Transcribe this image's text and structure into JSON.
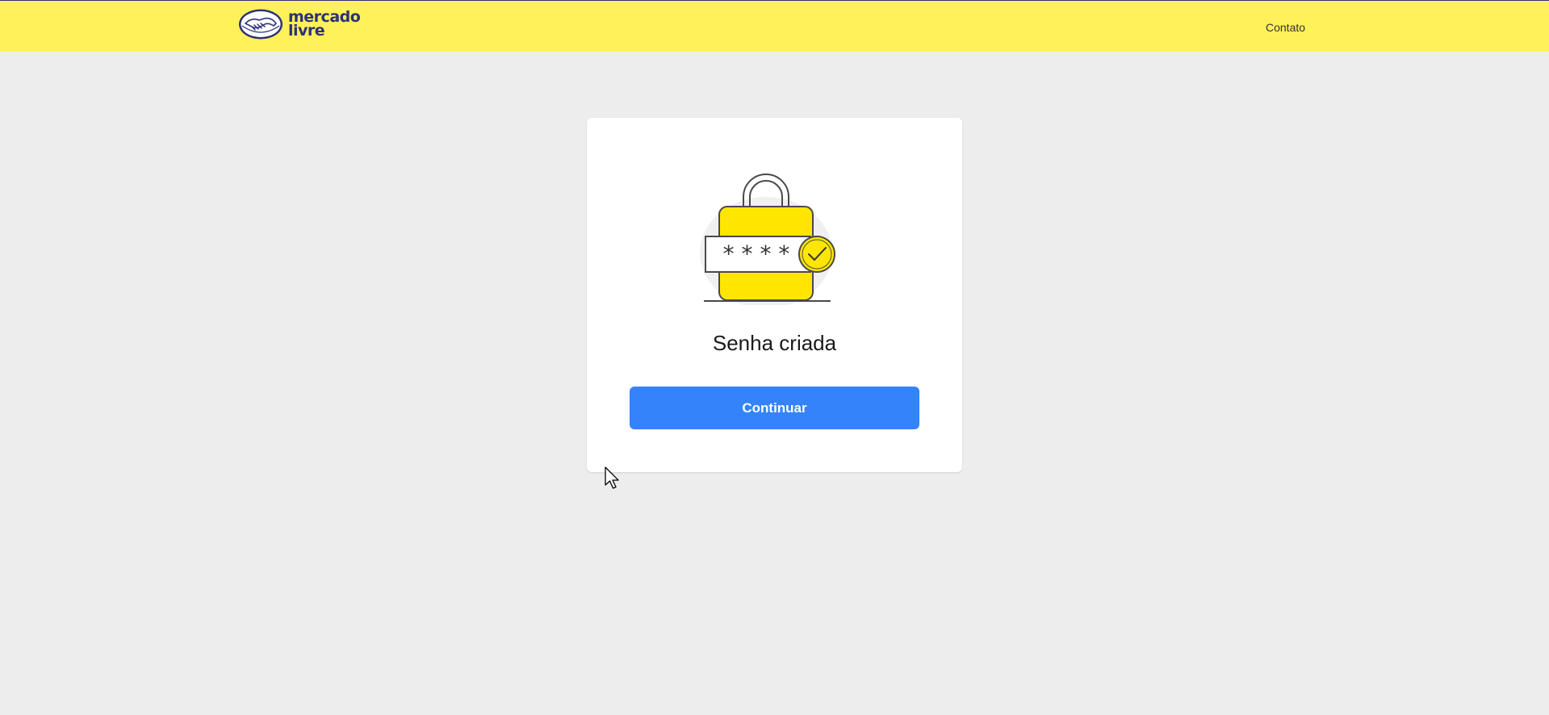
{
  "header": {
    "logo": {
      "line1": "mercado",
      "line2": "livre",
      "icon": "handshake-icon"
    },
    "contact_label": "Contato"
  },
  "card": {
    "illustration": {
      "icon": "padlock-password-check-icon",
      "mask": "* * * *"
    },
    "title": "Senha criada",
    "continue_label": "Continuar"
  },
  "colors": {
    "header_bg": "#fff159",
    "brand_navy": "#2d3277",
    "page_bg": "#ededed",
    "button_blue": "#3483fa",
    "lock_yellow": "#ffe600"
  }
}
